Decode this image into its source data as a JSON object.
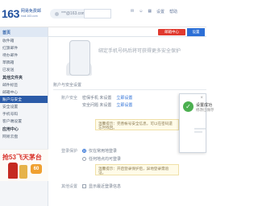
{
  "header": {
    "logo_number": "163",
    "logo_title": "网易免费邮",
    "logo_sub": "mail.163.com",
    "account": "***@163.com",
    "icons": [
      "mail-icon",
      "contacts-icon",
      "app-icon"
    ],
    "links": [
      "设置",
      "帮助"
    ]
  },
  "sidebar": {
    "header": "首页",
    "items": [
      {
        "label": "收件箱"
      },
      {
        "label": "红旗邮件"
      },
      {
        "label": "待办邮件"
      },
      {
        "label": "草稿箱"
      },
      {
        "label": "已发送"
      }
    ],
    "group1": "其他文件夹",
    "group1_items": [
      {
        "label": "邮件标签"
      },
      {
        "label": "邮箱中心"
      }
    ],
    "active_item": "账户与安全",
    "more_items": [
      {
        "label": "安全设置"
      },
      {
        "label": "手机号码"
      },
      {
        "label": "客户端设置"
      }
    ],
    "group2": "应用中心",
    "group2_items": [
      {
        "label": "网易云盘"
      }
    ]
  },
  "ad": {
    "title": "抢53飞天茅台",
    "badge": "60"
  },
  "tabs": {
    "red_label": "邮箱中心",
    "blue_label": "设置"
  },
  "main": {
    "banner_text": "绑定手机号码后将可获得更多安全保护",
    "section_title": "账户与安全设置",
    "account_label": "账户安全",
    "account_line1": "密保手机 未设置",
    "account_line2": "安全问题 未设置",
    "account_link1": "立即设置",
    "account_link2": "立即设置",
    "note1": "温馨提示：完善帐号安全信息，可以在密码遗忘时找回。",
    "login_label": "登录保护",
    "radio1": "仅在常用地登录",
    "radio2": "任何地点均可登录",
    "note2": "温馨提示：开启登录保护后，异地登录需验证。",
    "other_label": "其他设置",
    "check1": "显示最近登录信息"
  },
  "popup": {
    "title": "设置成功",
    "sub": "修改已保存",
    "close": "×"
  },
  "colors": {
    "brand_blue": "#2b5ba8",
    "accent_red": "#e03a2f",
    "success_green": "#4caf50"
  }
}
